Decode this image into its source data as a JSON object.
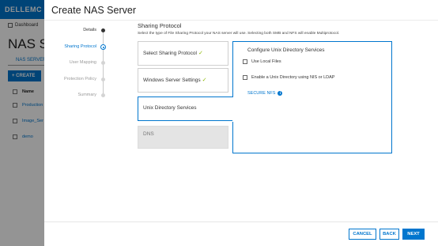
{
  "background": {
    "logo": "DELLEMC",
    "breadcrumb": "Dashboard",
    "page_title": "NAS Server",
    "tab": "NAS SERVER",
    "create_button": "+ CREATE",
    "table_header": "Name",
    "rows": [
      "Production",
      "Image_Ser",
      "demo"
    ]
  },
  "dialog": {
    "title": "Create NAS Server",
    "steps": [
      {
        "label": "Details",
        "state": "done"
      },
      {
        "label": "Sharing Protocol",
        "state": "active"
      },
      {
        "label": "User Mapping",
        "state": "pending"
      },
      {
        "label": "Protection Policy",
        "state": "pending"
      },
      {
        "label": "Summary",
        "state": "pending"
      }
    ],
    "section_title": "Sharing Protocol",
    "section_desc": "Select the type of File Sharing Protocol your NAS server will use. Selecting both SMB and NFS will enable Multiprotocol.",
    "tiles": {
      "select_sharing": "Select Sharing Protocol",
      "windows_settings": "Windows Server Settings",
      "unix_services": "Unix Directory Services",
      "dns": "DNS",
      "check_glyph": "✓"
    },
    "config": {
      "title": "Configure Unix Directory Services",
      "use_local_files": "Use Local Files",
      "enable_unix_directory": "Enable a Unix Directory using NIS or LDAP",
      "secure_nfs": "SECURE NFS",
      "info_glyph": "i"
    },
    "footer": {
      "cancel": "CANCEL",
      "back": "BACK",
      "next": "NEXT"
    }
  },
  "colors": {
    "accent": "#0076ce",
    "check": "#8ab800",
    "overlay": "rgba(0,0,0,0.42)"
  }
}
